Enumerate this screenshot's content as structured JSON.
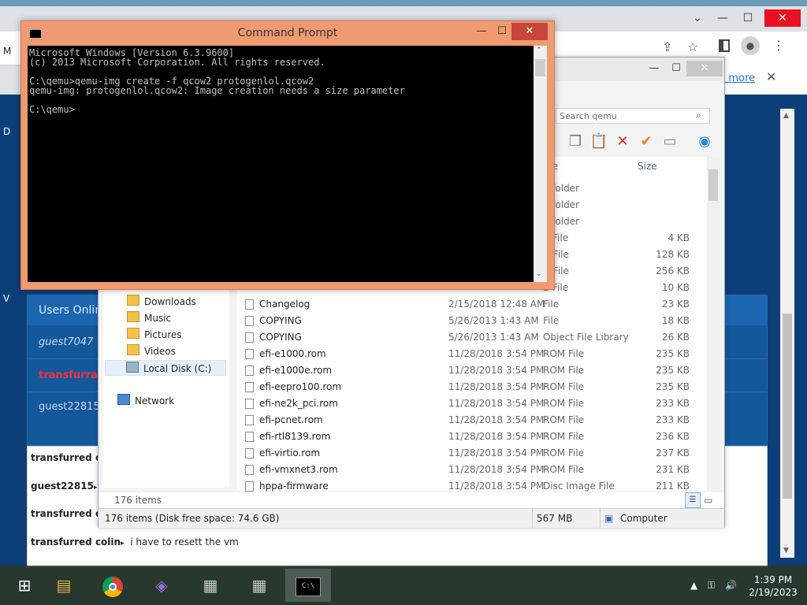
{
  "browser": {
    "tab_partial": "M",
    "left_edge_letters": [
      "D",
      "V"
    ],
    "learn_more": "n more",
    "close_x": "✕",
    "chat_panel_header": "Users Onlin",
    "users": [
      {
        "name": "guest7047",
        "style": "italic",
        "color": "#c5d7ee"
      },
      {
        "name": "transfurrac",
        "style": "bold",
        "color": "#ff3030"
      },
      {
        "name": "guest22815",
        "style": "normal",
        "color": "#c5d7ee"
      }
    ],
    "chat_lines": [
      {
        "user": "transfurred co",
        "msg": ""
      },
      {
        "user": "guest22815",
        "arrow": "▸",
        "msg": ""
      },
      {
        "user": "transfurred co",
        "msg": ""
      },
      {
        "user": "transfurred colin",
        "arrow": "▸",
        "msg": "i have to resett the vm"
      }
    ]
  },
  "explorer": {
    "search_placeholder": "Search qemu",
    "columns": {
      "type": "pe",
      "size": "Size"
    },
    "partial_rows": [
      {
        "type": "e folder",
        "size": ""
      },
      {
        "type": "e folder",
        "size": ""
      },
      {
        "type": "e folder",
        "size": ""
      },
      {
        "type": "B File",
        "size": "4 KB"
      },
      {
        "type": "N File",
        "size": "128 KB"
      },
      {
        "type": "N File",
        "size": "256 KB"
      },
      {
        "type": "B File",
        "size": "10 KB"
      }
    ],
    "nav_items": [
      {
        "label": "Downloads",
        "icon": "downloads-icon"
      },
      {
        "label": "Music",
        "icon": "music-icon"
      },
      {
        "label": "Pictures",
        "icon": "pictures-icon"
      },
      {
        "label": "Videos",
        "icon": "videos-icon"
      },
      {
        "label": "Local Disk (C:)",
        "icon": "disk-icon",
        "selected": true
      },
      {
        "label": "Network",
        "icon": "network-icon"
      }
    ],
    "files": [
      {
        "name": "Changelog",
        "date": "2/15/2018 12:48 AM",
        "type": "File",
        "size": "23 KB"
      },
      {
        "name": "COPYING",
        "date": "5/26/2013 1:43 AM",
        "type": "File",
        "size": "18 KB"
      },
      {
        "name": "COPYING",
        "date": "5/26/2013 1:43 AM",
        "type": "Object File Library",
        "size": "26 KB"
      },
      {
        "name": "efi-e1000.rom",
        "date": "11/28/2018 3:54 PM",
        "type": "ROM File",
        "size": "235 KB"
      },
      {
        "name": "efi-e1000e.rom",
        "date": "11/28/2018 3:54 PM",
        "type": "ROM File",
        "size": "235 KB"
      },
      {
        "name": "efi-eepro100.rom",
        "date": "11/28/2018 3:54 PM",
        "type": "ROM File",
        "size": "235 KB"
      },
      {
        "name": "efi-ne2k_pci.rom",
        "date": "11/28/2018 3:54 PM",
        "type": "ROM File",
        "size": "233 KB"
      },
      {
        "name": "efi-pcnet.rom",
        "date": "11/28/2018 3:54 PM",
        "type": "ROM File",
        "size": "233 KB"
      },
      {
        "name": "efi-rtl8139.rom",
        "date": "11/28/2018 3:54 PM",
        "type": "ROM File",
        "size": "236 KB"
      },
      {
        "name": "efi-virtio.rom",
        "date": "11/28/2018 3:54 PM",
        "type": "ROM File",
        "size": "237 KB"
      },
      {
        "name": "efi-vmxnet3.rom",
        "date": "11/28/2018 3:54 PM",
        "type": "ROM File",
        "size": "231 KB"
      },
      {
        "name": "hppa-firmware",
        "date": "11/28/2018 3:54 PM",
        "type": "Disc Image File",
        "size": "211 KB"
      }
    ],
    "item_count": "176 items",
    "status_left": "176 items (Disk free space: 74.6 GB)",
    "status_mid": "567 MB",
    "status_right": "Computer"
  },
  "cmd": {
    "title": "Command Prompt",
    "console_text": "Microsoft Windows [Version 6.3.9600]\n(c) 2013 Microsoft Corporation. All rights reserved.\n\nC:\\qemu>qemu-img create -f qcow2 protogenlol.qcow2\nqemu-img: protogenlol.qcow2: Image creation needs a size parameter\n\nC:\\qemu>"
  },
  "taskbar": {
    "time": "1:39 PM",
    "date": "2/19/2023"
  },
  "colors": {
    "cmd_frame": "#f09a72",
    "chat_bg": "#0c3f78",
    "selected_user": "#ff3030"
  }
}
